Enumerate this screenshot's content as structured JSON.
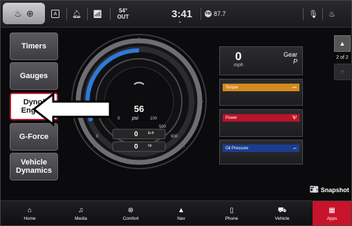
{
  "statusbar": {
    "time": "3:41",
    "outside_temp": "54°",
    "outside_label": "OUT",
    "radio_station": "87.7"
  },
  "menu": [
    {
      "label": "Timers",
      "active": false
    },
    {
      "label": "Gauges",
      "active": false
    },
    {
      "label": "Dyno/ Engine",
      "active": true
    },
    {
      "label": "G-Force",
      "active": false
    },
    {
      "label": "Vehicle Dynamics",
      "active": false
    }
  ],
  "gauge": {
    "value": "56",
    "unit": "psi",
    "ticks": [
      "0",
      "100",
      "500",
      "0",
      "500"
    ],
    "torque_value": "0",
    "torque_unit": "lb-ft",
    "power_value": "0",
    "power_unit": "hp"
  },
  "panels": {
    "speed_value": "0",
    "speed_unit": "mph",
    "gear_label": "Gear",
    "gear_value": "P",
    "torque_label": "Torque",
    "power_label": "Power",
    "oil_label": "Oil Pressure"
  },
  "colors": {
    "torque": "#d4891f",
    "power": "#b8142a",
    "oil": "#1a3d8f",
    "accent": "#c8142b",
    "gauge_blue": "#2f7ad8"
  },
  "pager": {
    "indicator": "2 of 2"
  },
  "snapshot_label": "Snapshot",
  "bottom_nav": [
    {
      "label": "Home",
      "icon": "home-icon"
    },
    {
      "label": "Media",
      "icon": "music-note-icon"
    },
    {
      "label": "Comfort",
      "icon": "comfort-icon"
    },
    {
      "label": "Nav",
      "icon": "navigation-arrow-icon"
    },
    {
      "label": "Phone",
      "icon": "phone-icon"
    },
    {
      "label": "Vehicle",
      "icon": "car-icon"
    },
    {
      "label": "Apps",
      "icon": "apps-grid-icon"
    }
  ]
}
